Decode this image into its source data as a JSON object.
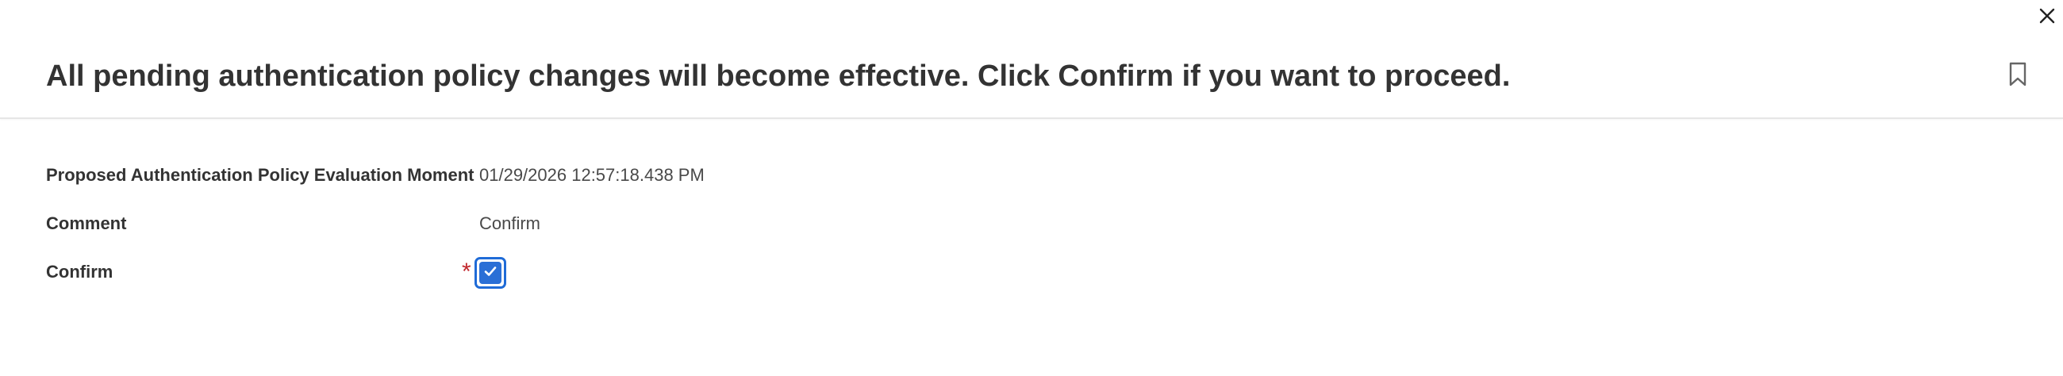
{
  "dialog": {
    "title": "All pending authentication policy changes will become effective. Click Confirm if you want to proceed.",
    "close_icon": "close-icon",
    "bookmark_icon": "bookmark-icon"
  },
  "fields": {
    "evaluation_moment": {
      "label": "Proposed Authentication Policy Evaluation Moment",
      "value": "01/29/2026 12:57:18.438 PM"
    },
    "comment": {
      "label": "Comment",
      "value": "Confirm"
    },
    "confirm": {
      "label": "Confirm",
      "required_marker": "*",
      "checked": true
    }
  },
  "colors": {
    "accent": "#2a6fd6",
    "required": "#c1272d",
    "text": "#333333"
  }
}
